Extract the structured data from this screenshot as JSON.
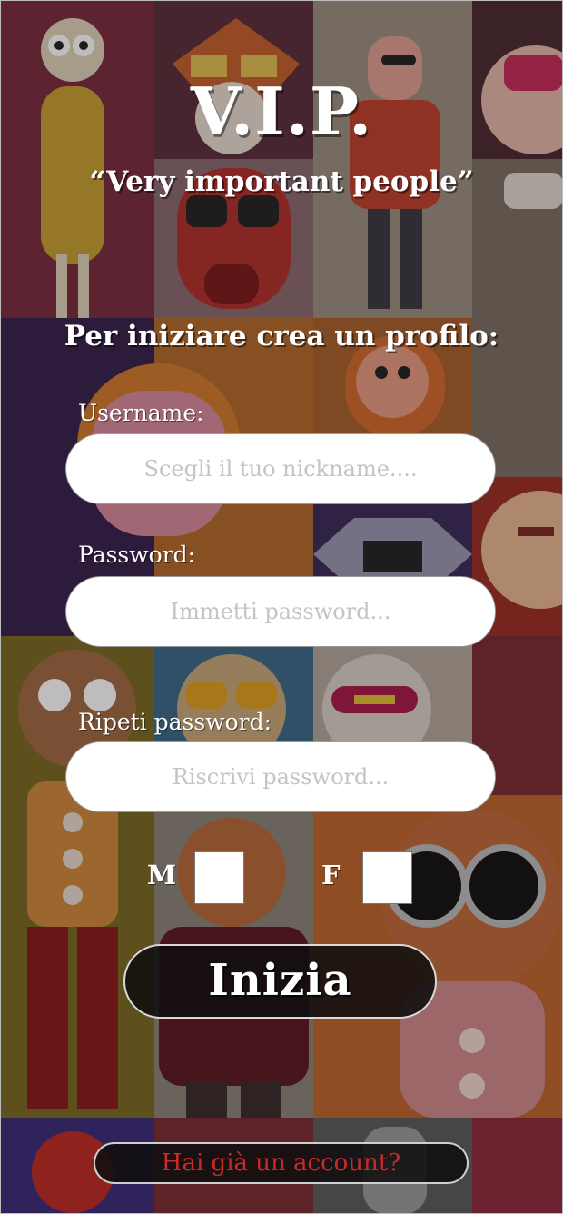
{
  "app": {
    "title": "V.I.P.",
    "subtitle": "“Very important people”"
  },
  "form": {
    "prompt": "Per iniziare crea un profilo:",
    "username": {
      "label": "Username:",
      "placeholder": "Scegli il tuo nickname...."
    },
    "password": {
      "label": "Password:",
      "placeholder": "Immetti password..."
    },
    "repeat_password": {
      "label": "Ripeti password:",
      "placeholder": "Riscrivi password..."
    },
    "gender": {
      "male_label": "M",
      "female_label": "F"
    },
    "submit_label": "Inizia",
    "login_link": "Hai già un account?"
  },
  "colors": {
    "link_text": "#c92a2a",
    "button_bg": "#100e0f",
    "field_bg": "#ffffff"
  }
}
